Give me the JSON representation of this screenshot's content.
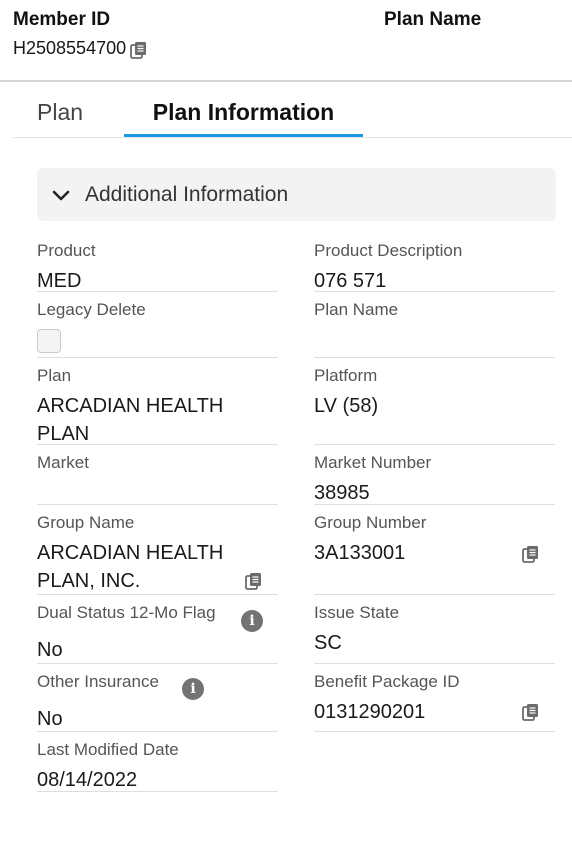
{
  "header": {
    "member_id_label": "Member ID",
    "member_id_value": "H2508554700",
    "plan_name_label": "Plan Name"
  },
  "tabs": [
    {
      "label": "Plan",
      "active": false
    },
    {
      "label": "Plan Information",
      "active": true
    }
  ],
  "section": {
    "title": "Additional Information",
    "expanded": true
  },
  "fields": {
    "product": {
      "label": "Product",
      "value": "MED"
    },
    "product_description": {
      "label": "Product Description",
      "value": "076 571"
    },
    "legacy_delete": {
      "label": "Legacy Delete",
      "checked": false
    },
    "plan_name": {
      "label": "Plan Name",
      "value": ""
    },
    "plan": {
      "label": "Plan",
      "value": "ARCADIAN HEALTH PLAN"
    },
    "platform": {
      "label": "Platform",
      "value": "LV (58)"
    },
    "market": {
      "label": "Market",
      "value": ""
    },
    "market_number": {
      "label": "Market Number",
      "value": "38985"
    },
    "group_name": {
      "label": "Group Name",
      "value": "ARCADIAN HEALTH PLAN, INC."
    },
    "group_number": {
      "label": "Group Number",
      "value": "3A133001"
    },
    "dual_status": {
      "label": "Dual Status 12-Mo Flag",
      "value": "No"
    },
    "issue_state": {
      "label": "Issue State",
      "value": "SC"
    },
    "other_insurance": {
      "label": "Other Insurance",
      "value": "No"
    },
    "benefit_package_id": {
      "label": "Benefit Package ID",
      "value": "0131290201"
    },
    "last_modified_date": {
      "label": "Last Modified Date",
      "value": "08/14/2022"
    }
  },
  "icons": {
    "copy": "copy-icon",
    "info": "info-icon",
    "chevron": "chevron-down-icon"
  },
  "colors": {
    "active_tab_underline": "#1b96e0",
    "section_background": "#f3f3f3",
    "icon_gray": "#6b6b6b"
  }
}
